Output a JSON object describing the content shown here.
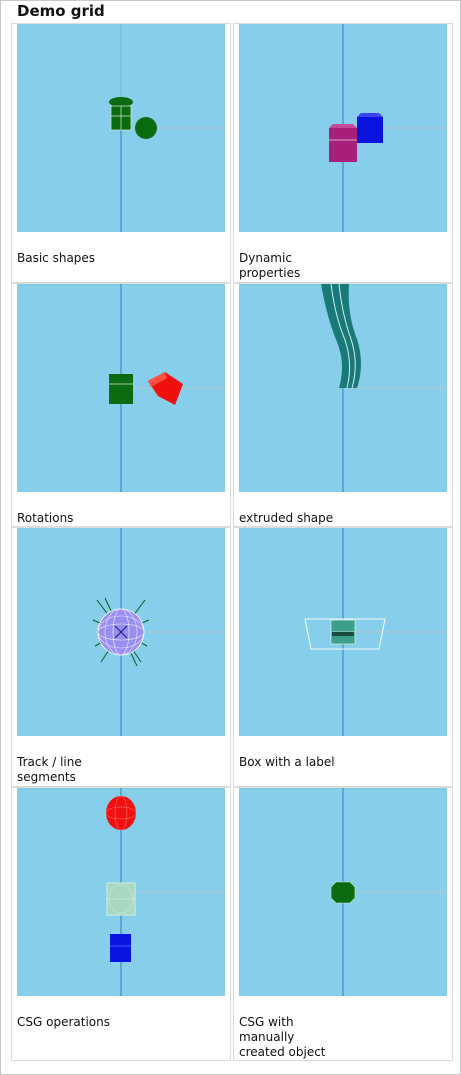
{
  "title": "Demo grid",
  "cells": [
    {
      "caption": "Basic shapes"
    },
    {
      "caption": "Dynamic\nproperties"
    },
    {
      "caption": "Rotations"
    },
    {
      "caption": "extruded shape"
    },
    {
      "caption": "Track / line\nsegments"
    },
    {
      "caption": "Box with a label"
    },
    {
      "caption": "CSG operations"
    },
    {
      "caption": "CSG with\nmanually\ncreated object"
    }
  ],
  "colors": {
    "viewport_bg": "#87ceea",
    "axis_light": "#b0d4de",
    "axis_vertical": "#5aa8d8",
    "green": "#0b6b10",
    "magenta": "#a8207a",
    "blue": "#0a14e0",
    "red": "#f01010",
    "teal": "#1a7a78",
    "lilac": "#9a8ef0"
  }
}
